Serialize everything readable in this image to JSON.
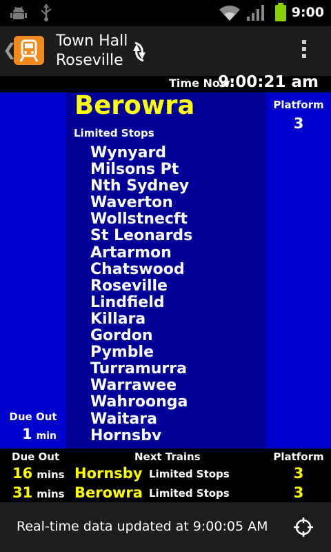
{
  "status_bar": {
    "time": "9:00",
    "icons": [
      "android-debug-icon",
      "usb-icon",
      "wifi-icon",
      "signal-icon",
      "battery-icon"
    ]
  },
  "action_bar": {
    "origin": "Town Hall",
    "destination": "Roseville",
    "icons": [
      "back-chevron-icon",
      "train-app-icon",
      "swap-direction-icon",
      "overflow-menu-icon"
    ]
  },
  "time_now": {
    "label": "Time Now:",
    "value": "9:00:21 am"
  },
  "next_train": {
    "destination": "Berowra",
    "service_type": "Limited Stops",
    "stops": [
      "Wynyard",
      "Milsons Pt",
      "Nth Sydney",
      "Waverton",
      "Wollstnecft",
      "St Leonards",
      "Artarmon",
      "Chatswood",
      "Roseville",
      "Lindfield",
      "Killara",
      "Gordon",
      "Pymble",
      "Turramurra",
      "Warrawee",
      "Wahroonga",
      "Waitara",
      "Hornsby"
    ],
    "platform_label": "Platform",
    "platform": "3",
    "due_label": "Due Out",
    "due_value": "1",
    "due_unit": "min"
  },
  "following": {
    "headers": {
      "due": "Due Out",
      "trains": "Next Trains",
      "platform": "Platform"
    },
    "rows": [
      {
        "mins": "16",
        "unit": "mins",
        "destination": "Hornsby",
        "type": "Limited Stops",
        "platform": "3"
      },
      {
        "mins": "31",
        "unit": "mins",
        "destination": "Berowra",
        "type": "Limited Stops",
        "platform": "3"
      }
    ]
  },
  "footer": {
    "text": "Real-time data updated at 9:00:05 AM",
    "icon": "location-target-icon"
  },
  "colors": {
    "board_blue": "#0000cc",
    "board_dark": "#000099",
    "highlight": "#ffff00",
    "app_orange": "#f08a1e"
  }
}
